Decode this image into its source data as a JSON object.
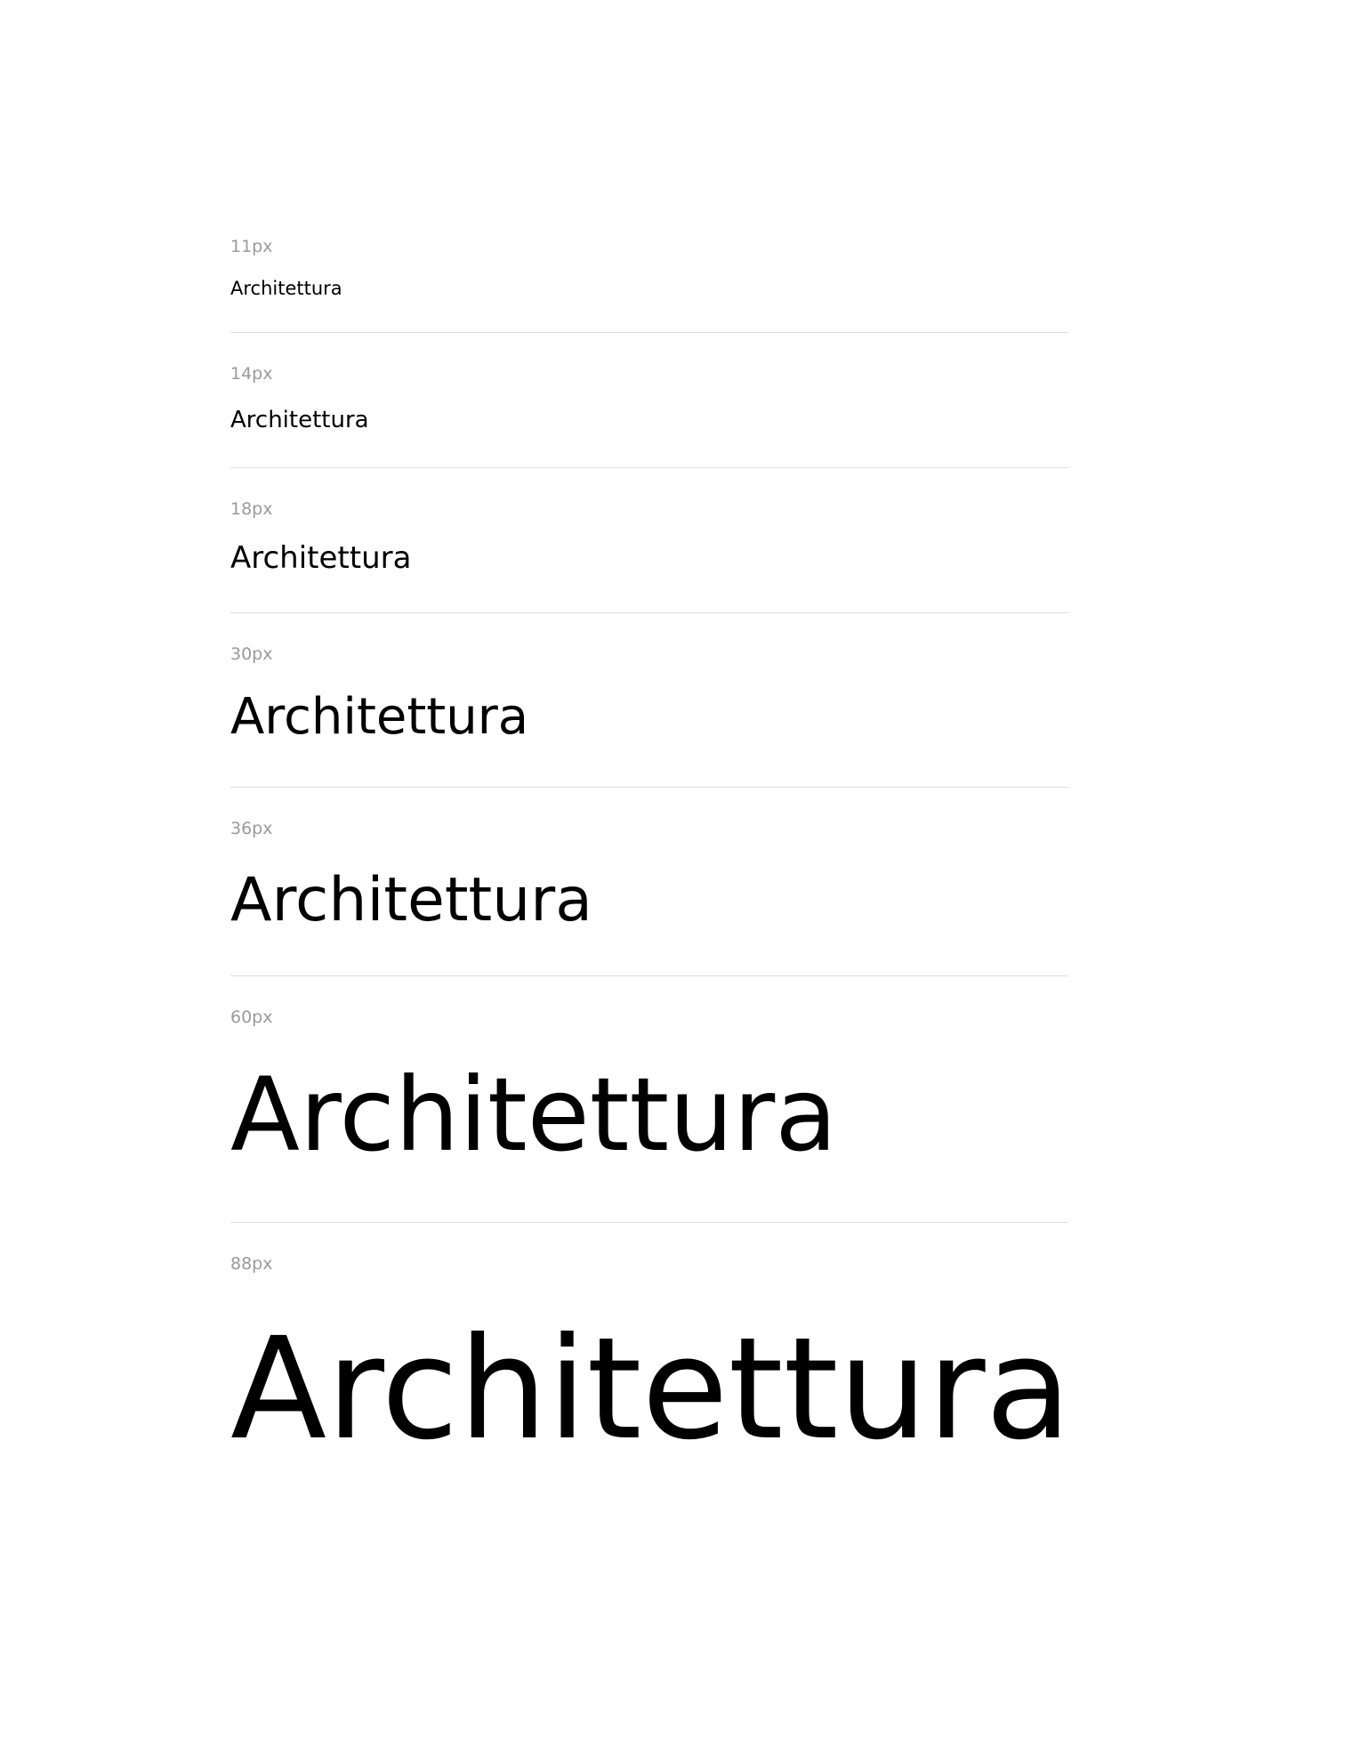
{
  "type_scale": {
    "sample_text": "Architettura",
    "rows": [
      {
        "label": "11px",
        "sample": "Architettura"
      },
      {
        "label": "14px",
        "sample": "Architettura"
      },
      {
        "label": "18px",
        "sample": "Architettura"
      },
      {
        "label": "30px",
        "sample": "Architettura"
      },
      {
        "label": "36px",
        "sample": "Architettura"
      },
      {
        "label": "60px",
        "sample": "Architettura"
      },
      {
        "label": "88px",
        "sample": "Architettura"
      }
    ]
  },
  "colors": {
    "label_text": "#9a9a9a",
    "sample_text": "#000000",
    "divider": "#dddddd",
    "background": "#ffffff"
  }
}
